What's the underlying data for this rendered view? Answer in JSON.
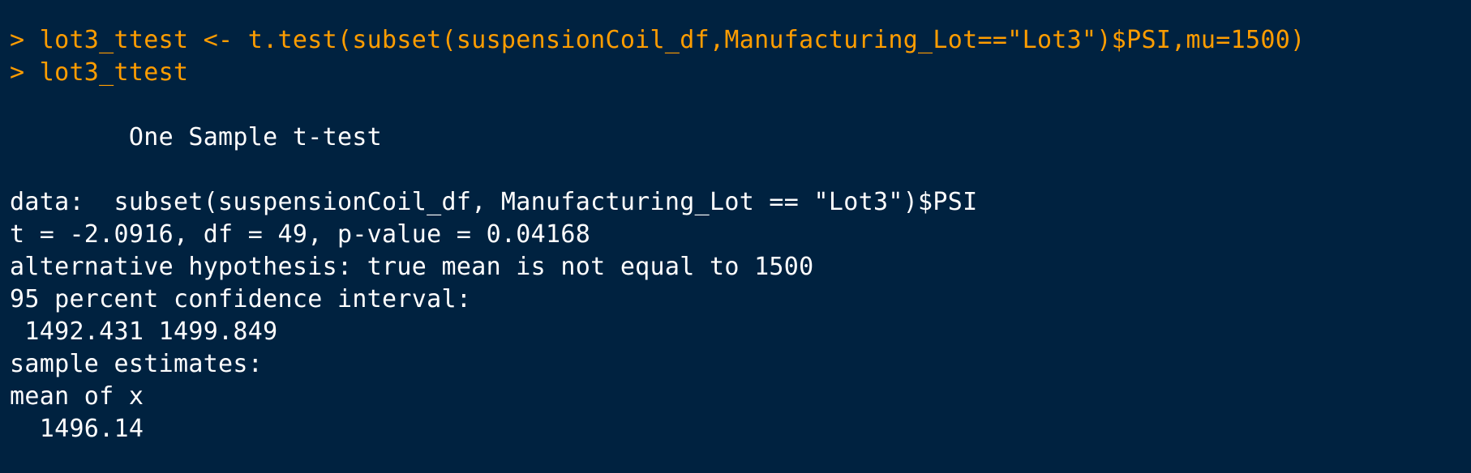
{
  "theme": {
    "background": "#002240",
    "input_color": "#FF9D00",
    "output_color": "#FFFFFF"
  },
  "console": {
    "lines": [
      {
        "type": "input",
        "text": "> lot3_ttest <- t.test(subset(suspensionCoil_df,Manufacturing_Lot==\"Lot3\")$PSI,mu=1500)"
      },
      {
        "type": "input",
        "text": "> lot3_ttest"
      },
      {
        "type": "blank",
        "text": ""
      },
      {
        "type": "output",
        "text": "        One Sample t-test"
      },
      {
        "type": "blank",
        "text": ""
      },
      {
        "type": "output",
        "text": "data:  subset(suspensionCoil_df, Manufacturing_Lot == \"Lot3\")$PSI"
      },
      {
        "type": "output",
        "text": "t = -2.0916, df = 49, p-value = 0.04168"
      },
      {
        "type": "output",
        "text": "alternative hypothesis: true mean is not equal to 1500"
      },
      {
        "type": "output",
        "text": "95 percent confidence interval:"
      },
      {
        "type": "output",
        "text": " 1492.431 1499.849"
      },
      {
        "type": "output",
        "text": "sample estimates:"
      },
      {
        "type": "output",
        "text": "mean of x "
      },
      {
        "type": "output",
        "text": "  1496.14 "
      }
    ]
  }
}
